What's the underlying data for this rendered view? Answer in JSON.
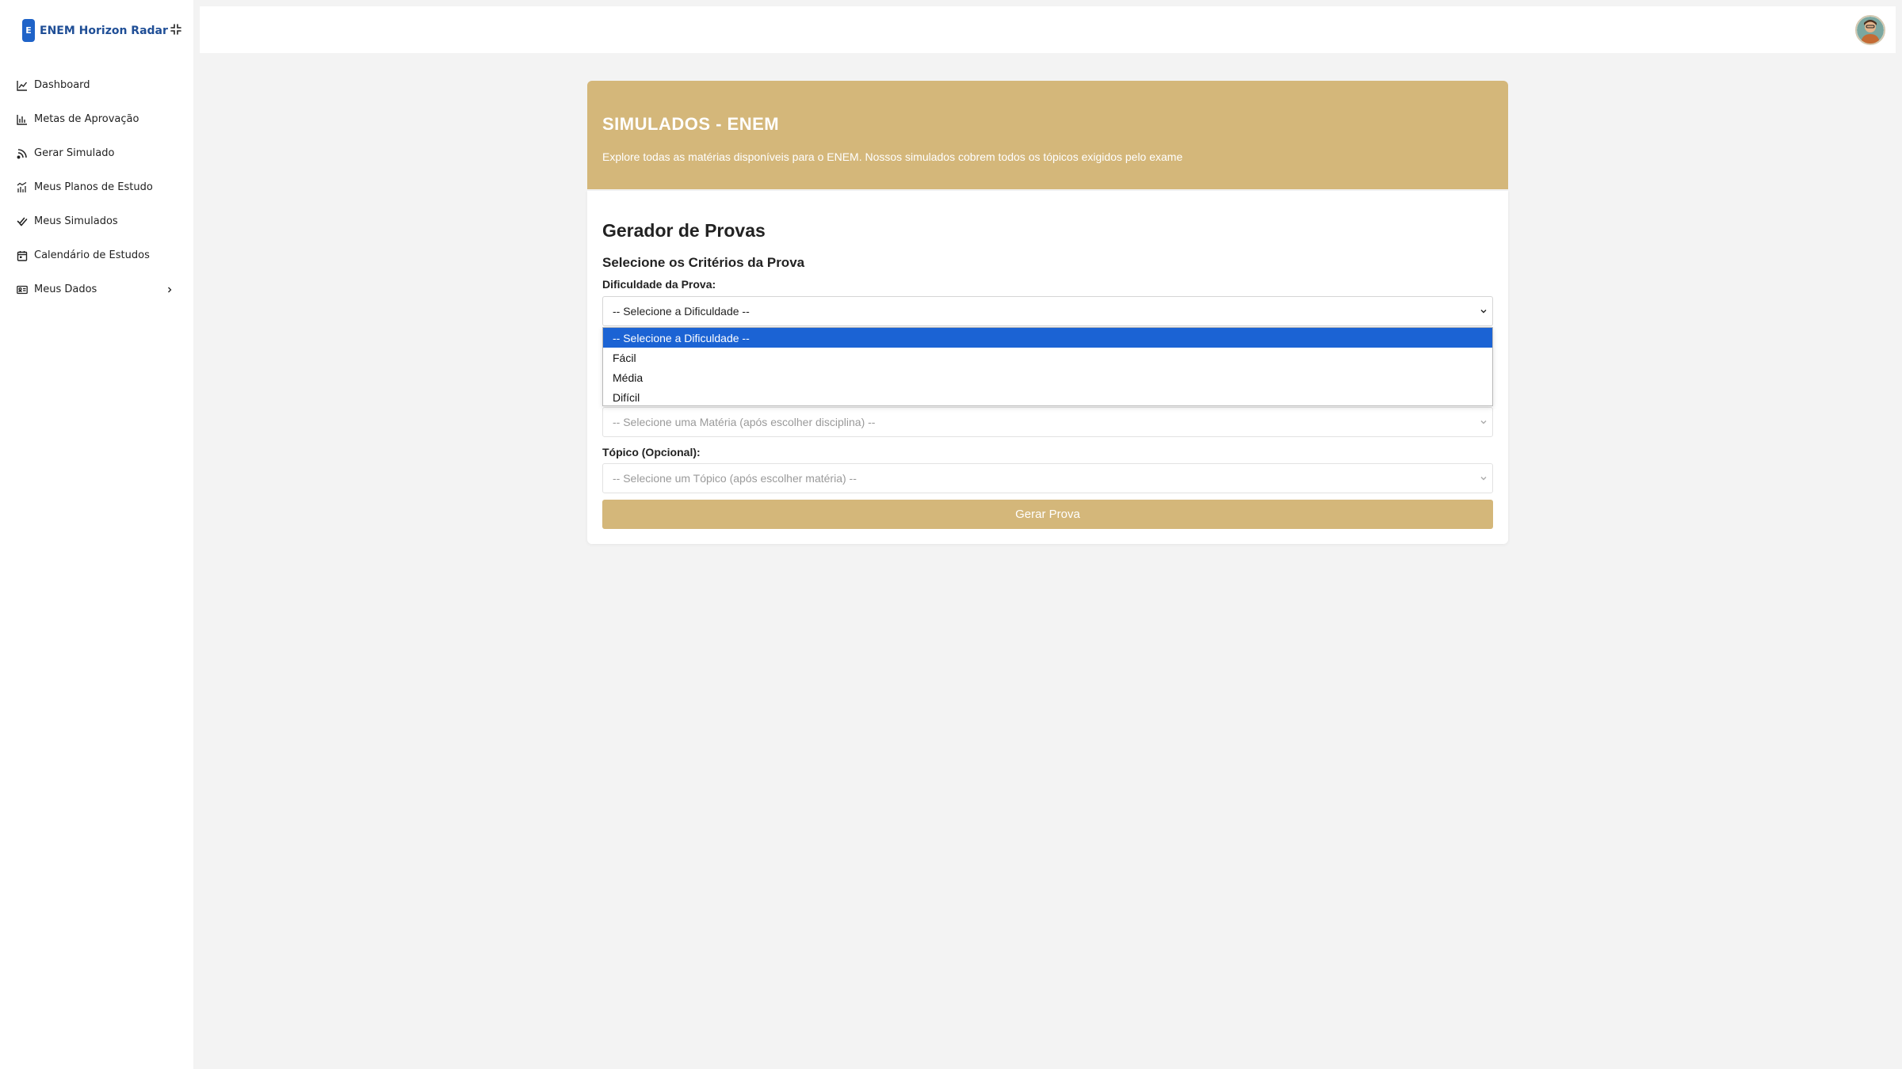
{
  "brand": {
    "badge": "E",
    "name": "ENEM Horizon Radar"
  },
  "sidebar": {
    "items": [
      {
        "label": "Dashboard",
        "icon": "chart-line-icon"
      },
      {
        "label": "Metas de Aprovação",
        "icon": "bar-chart-icon"
      },
      {
        "label": "Gerar Simulado",
        "icon": "rss-icon"
      },
      {
        "label": "Meus Planos de Estudo",
        "icon": "chart-mixed-icon"
      },
      {
        "label": "Meus Simulados",
        "icon": "double-check-icon"
      },
      {
        "label": "Calendário de Estudos",
        "icon": "calendar-icon"
      },
      {
        "label": "Meus Dados",
        "icon": "id-card-icon",
        "has_submenu": true
      }
    ]
  },
  "hero": {
    "title": "SIMULADOS - ENEM",
    "subtitle": "Explore todas as matérias disponíveis para o ENEM. Nossos simulados cobrem todos os tópicos exigidos pelo exame"
  },
  "form": {
    "title": "Gerador de Provas",
    "subtitle": "Selecione os Critérios da Prova",
    "difficulty": {
      "label": "Dificuldade da Prova:",
      "value": "-- Selecione a Dificuldade --",
      "options": [
        "-- Selecione a Dificuldade --",
        "Fácil",
        "Média",
        "Difícil"
      ],
      "selected_index": 0
    },
    "subject": {
      "value": "-- Selecione uma Matéria (após escolher disciplina) --"
    },
    "topic": {
      "label": "Tópico (Opcional):",
      "value": "-- Selecione um Tópico (após escolher matéria) --"
    },
    "submit_label": "Gerar Prova"
  },
  "colors": {
    "accent": "#d4b77a",
    "brand_blue": "#1f63c8",
    "selected_option": "#1b63d4",
    "background": "#f3f3f3"
  }
}
